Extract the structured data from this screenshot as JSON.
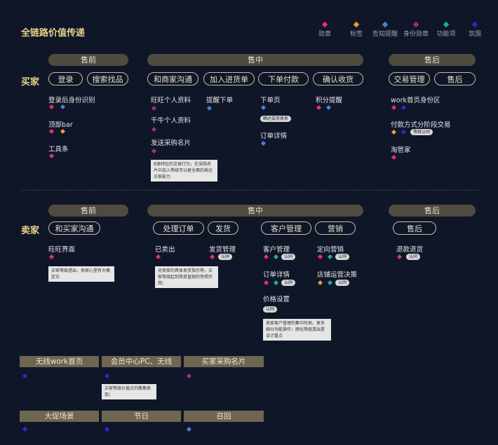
{
  "title": "全链路价值传递",
  "colors": {
    "rank": "#e2306b",
    "tag": "#f09a2a",
    "notify": "#4b7fd6",
    "identity": "#a12a8c",
    "feature": "#17b38e",
    "atmosphere": "#3b22d6"
  },
  "legend": [
    {
      "label": "勋章",
      "color": "#e2306b",
      "icon": "rank-diamond-icon"
    },
    {
      "label": "标签",
      "color": "#f09a2a",
      "icon": "tag-diamond-icon"
    },
    {
      "label": "告知提醒",
      "color": "#4b7fd6",
      "icon": "notify-diamond-icon"
    },
    {
      "label": "身份勋章",
      "color": "#a12a8c",
      "icon": "identity-diamond-icon"
    },
    {
      "label": "功能项",
      "color": "#17b38e",
      "icon": "feature-diamond-icon"
    },
    {
      "label": "氛围",
      "color": "#3b22d6",
      "icon": "atmosphere-diamond-icon"
    }
  ],
  "buyer": {
    "label": "买家",
    "phases": [
      "售前",
      "售中",
      "售后"
    ],
    "pills": [
      "登录",
      "搜索找品",
      "和商家沟通",
      "加入进货单",
      "下单付款",
      "确认收货",
      "交易管理",
      "售后"
    ],
    "items": [
      "登录后身份识别",
      "顶部bar",
      "工具条",
      "旺旺个人资料",
      "千牛个人资料",
      "发送采购名片",
      "提醒下单",
      "下单页",
      "订单详情",
      "积分提醒",
      "work首页身份区",
      "付款方式分阶段交易",
      "淘管家"
    ],
    "tags": [
      "触达会员体系",
      "等级认同"
    ],
    "notes": [
      "B类特征的交易行为，在采购名片中加入等级可以更全面的表达买家能力"
    ]
  },
  "seller": {
    "label": "卖家",
    "phases": [
      "售前",
      "售中",
      "售后"
    ],
    "pills": [
      "和买家沟通",
      "处理订单",
      "发货",
      "客户管理",
      "营销",
      "售后"
    ],
    "items": [
      "旺旺界面",
      "已卖出",
      "发货管理",
      "客户管理",
      "订单详情",
      "价格设置",
      "定向营销",
      "店铺运营决策",
      "退款退货"
    ],
    "tags": [
      "认同",
      "认同",
      "认同",
      "认同",
      "认同",
      "认同",
      "认同"
    ],
    "notes": [
      "买家等级透出，卖家心里有大概定位",
      "对卖家的具体发货指示等，买家等级起到简单直观的参照作用；",
      "卖家客户管理的集中阵地，更多细分功能操作；随化等级透出提设计重点"
    ]
  },
  "extra": {
    "row1": [
      "无线work首页",
      "会员中心PC、无线",
      "买家采购名片"
    ],
    "row1_note": "买家等级价值点的聚集表现；",
    "row2": [
      "大促场景",
      "节日",
      "召回"
    ]
  }
}
